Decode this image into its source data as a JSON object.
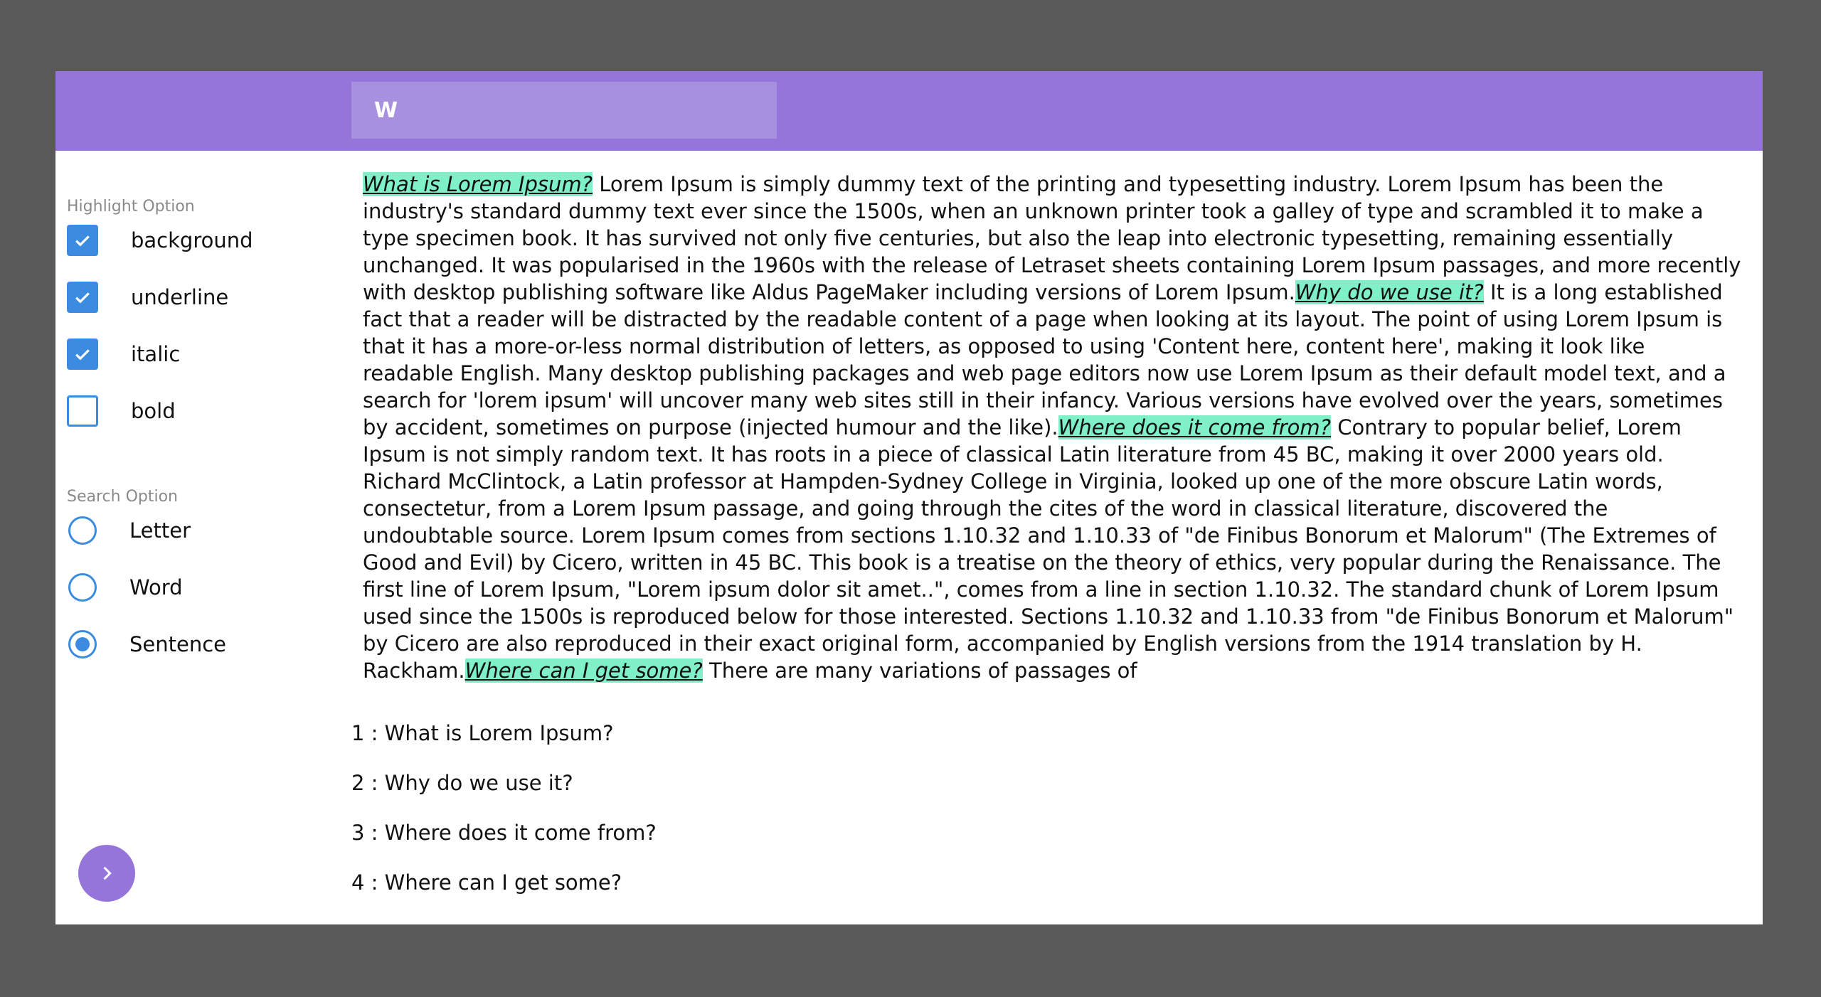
{
  "search": {
    "value": "W"
  },
  "sidebar": {
    "highlight_title": "Highlight Option",
    "highlight_options": [
      {
        "label": "background",
        "checked": true
      },
      {
        "label": "underline",
        "checked": true
      },
      {
        "label": "italic",
        "checked": true
      },
      {
        "label": "bold",
        "checked": false
      }
    ],
    "search_title": "Search Option",
    "search_options": [
      {
        "label": "Letter",
        "selected": false
      },
      {
        "label": "Word",
        "selected": false
      },
      {
        "label": "Sentence",
        "selected": true
      }
    ]
  },
  "content": {
    "blocks": [
      {
        "heading": "What is Lorem Ipsum?",
        "text": " Lorem Ipsum is simply dummy text of the printing and typesetting industry. Lorem Ipsum has been the industry's standard dummy text ever since the 1500s, when an unknown printer took a galley of type and scrambled it to make a type specimen book. It has survived not only five centuries, but also the leap into electronic typesetting, remaining essentially unchanged. It was popularised in the 1960s with the release of Letraset sheets containing Lorem Ipsum passages, and more recently with desktop publishing software like Aldus PageMaker including versions of Lorem Ipsum."
      },
      {
        "heading": "Why do we use it?",
        "text": " It is a long established fact that a reader will be distracted by the readable content of a page when looking at its layout. The point of using Lorem Ipsum is that it has a more-or-less normal distribution of letters, as opposed to using 'Content here, content here', making it look like readable English. Many desktop publishing packages and web page editors now use Lorem Ipsum as their default model text, and a search for 'lorem ipsum' will uncover many web sites still in their infancy. Various versions have evolved over the years, sometimes by accident, sometimes on purpose (injected humour and the like)."
      },
      {
        "heading": "Where does it come from?",
        "text": " Contrary to popular belief, Lorem Ipsum is not simply random text. It has roots in a piece of classical Latin literature from 45 BC, making it over 2000 years old. Richard McClintock, a Latin professor at Hampden-Sydney College in Virginia, looked up one of the more obscure Latin words, consectetur, from a Lorem Ipsum passage, and going through the cites of the word in classical literature, discovered the undoubtable source. Lorem Ipsum comes from sections 1.10.32 and 1.10.33 of \"de Finibus Bonorum et Malorum\" (The Extremes of Good and Evil) by Cicero, written in 45 BC. This book is a treatise on the theory of ethics, very popular during the Renaissance. The first line of Lorem Ipsum, \"Lorem ipsum dolor sit amet..\", comes from a line in section 1.10.32. The standard chunk of Lorem Ipsum used since the 1500s is reproduced below for those interested. Sections 1.10.32 and 1.10.33 from \"de Finibus Bonorum et Malorum\" by Cicero are also reproduced in their exact original form, accompanied by English versions from the 1914 translation by H. Rackham."
      },
      {
        "heading": "Where can I get some?",
        "text": " There are many variations of passages of"
      }
    ]
  },
  "results": [
    "1 : What is Lorem Ipsum?",
    "2 : Why do we use it?",
    "3 : Where does it come from?",
    "4 : Where can I get some?"
  ],
  "colors": {
    "accent": "#9575d9",
    "highlight": "#7ff0c8",
    "checkbox": "#3b8ce0",
    "backdrop": "#595959"
  },
  "fab_icon": "chevron-right-icon"
}
